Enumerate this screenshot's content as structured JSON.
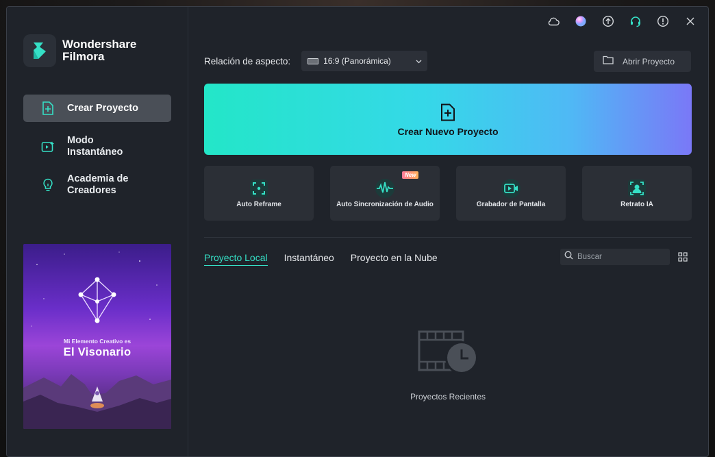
{
  "app": {
    "brand_line1": "Wondershare",
    "brand_line2": "Filmora"
  },
  "sidebar": {
    "items": [
      {
        "label": "Crear Proyecto",
        "icon": "new-file-plus-icon",
        "active": true
      },
      {
        "label": "Modo Instantáneo",
        "icon": "instant-mode-icon",
        "active": false
      },
      {
        "label": "Academia de Creadores",
        "icon": "lightbulb-icon",
        "active": false
      }
    ],
    "promo": {
      "subtitle": "Mi Elemento Creativo es",
      "title": "El Visonario"
    }
  },
  "topbar": {
    "icons": [
      "cloud-icon",
      "avatar-icon",
      "upload-icon",
      "headset-icon",
      "info-icon",
      "close-icon"
    ]
  },
  "aspect": {
    "label": "Relación de aspecto:",
    "value": "16:9 (Panorámica)"
  },
  "open_project": {
    "label": "Abrir Proyecto"
  },
  "create": {
    "label": "Crear Nuevo Proyecto"
  },
  "tools": [
    {
      "label": "Auto Reframe",
      "icon": "reframe-icon",
      "badge": ""
    },
    {
      "label": "Auto Sincronización de Audio",
      "icon": "audio-wave-icon",
      "badge": "New"
    },
    {
      "label": "Grabador de Pantalla",
      "icon": "screen-recorder-icon",
      "badge": ""
    },
    {
      "label": "Retrato IA",
      "icon": "portrait-icon",
      "badge": ""
    }
  ],
  "tabs": [
    {
      "label": "Proyecto Local",
      "active": true
    },
    {
      "label": "Instantáneo",
      "active": false
    },
    {
      "label": "Proyecto en la Nube",
      "active": false
    }
  ],
  "search": {
    "placeholder": "Buscar"
  },
  "empty": {
    "label": "Proyectos Recientes"
  },
  "colors": {
    "accent": "#35e0c6",
    "panel": "#2b2f36",
    "bg": "#1f232a"
  }
}
